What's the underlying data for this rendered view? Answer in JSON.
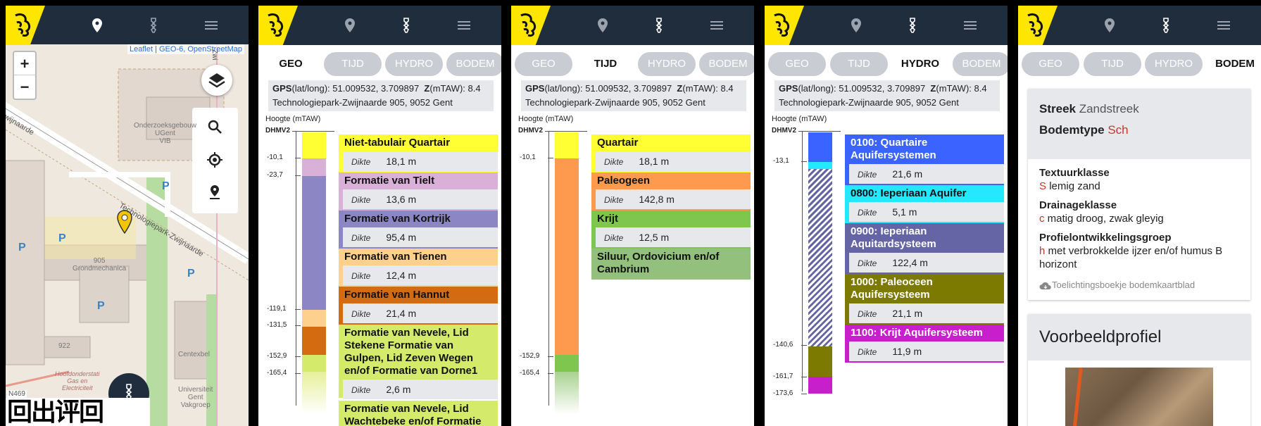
{
  "map": {
    "attribution": "Leaflet | GEO-6, OpenStreetMap",
    "zoom_in": "+",
    "zoom_out": "−",
    "labels": {
      "road1": "Technologiepark-Zwijnaarde",
      "road2": "wijnaarde",
      "bld1": "Onderzoeksgebouw\nUGent\nVIB",
      "bld2": "905\nGrondmechanica",
      "bld3": "922",
      "bld4": "Centexbel",
      "bld5": "Universiteit\nGent\nVakgroep",
      "bld6": "Hoofdonderstati\nGas en\nElectriciteit",
      "road3": "N469",
      "p": "P",
      "side": "Zwi"
    }
  },
  "info": {
    "gps_label": "GPS",
    "gps_text": "(lat/long): 51.009532, 3.709897",
    "z_label": "Z",
    "z_text": "(mTAW): 8.4",
    "address": "Technologiepark-Zwijnaarde 905, 9052 Gent"
  },
  "tabs": [
    "GEO",
    "TIJD",
    "HYDRO",
    "BODEM"
  ],
  "hoogte": "Hoogte (mTAW)",
  "dhmv": "DHMV2",
  "dikte": "Dikte",
  "geo": {
    "ticks": [
      "-10,1",
      "-23,7",
      "-119,1",
      "-131,5",
      "-152,9",
      "-165,4"
    ],
    "layers": [
      {
        "name": "Niet-tabulair Quartair",
        "d": "18,1 m",
        "color": "#ffff33"
      },
      {
        "name": "Formatie van Tielt",
        "d": "13,6 m",
        "color": "#d8b0d8"
      },
      {
        "name": "Formatie van Kortrijk",
        "d": "95,4 m",
        "color": "#8d86c4"
      },
      {
        "name": "Formatie van Tienen",
        "d": "12,4 m",
        "color": "#fdd08d"
      },
      {
        "name": "Formatie van Hannut",
        "d": "21,4 m",
        "color": "#d56b10"
      },
      {
        "name": "Formatie van Nevele, Lid Stekene Formatie van Gulpen, Lid Zeven Wegen en/of Formatie van Dorne1",
        "d": "2,6 m",
        "color": "#d4ea6b"
      },
      {
        "name": "Formatie van Nevele, Lid Wachtebeke en/of Formatie van",
        "d": "",
        "color": "#d4ea6b"
      }
    ]
  },
  "tijd": {
    "ticks": [
      "-10,1",
      "-152,9",
      "-165,4"
    ],
    "layers": [
      {
        "name": "Quartair",
        "d": "18,1 m",
        "color": "#ffff33"
      },
      {
        "name": "Paleogeen",
        "d": "142,8 m",
        "color": "#fd9a4e"
      },
      {
        "name": "Krijt",
        "d": "12,5 m",
        "color": "#7fc64e"
      },
      {
        "name": "Siluur, Ordovicium en/of Cambrium",
        "d": "",
        "color": "#93c07c"
      }
    ]
  },
  "hydro": {
    "ticks": [
      "-13,1",
      "-140,6",
      "-161,7",
      "-173,6"
    ],
    "layers": [
      {
        "name": "0100: Quartaire Aquifersystemen",
        "d": "21,6 m",
        "color": "#3a63ff",
        "dark": true
      },
      {
        "name": "0800: Ieperiaan Aquifer",
        "d": "5,1 m",
        "color": "#24e8ff"
      },
      {
        "name": "0900: Ieperiaan Aquitardsysteem",
        "d": "122,4 m",
        "color": "#6565a6",
        "dark": true
      },
      {
        "name": "1000: Paleoceen Aquifersysteem",
        "d": "21,1 m",
        "color": "#7c7a00",
        "dark": true
      },
      {
        "name": "1100: Krijt Aquifersysteem",
        "d": "11,9 m",
        "color": "#c81ecb",
        "dark": true
      }
    ]
  },
  "bodem": {
    "streek_label": "Streek",
    "streek": "Zandstreek",
    "type_label": "Bodemtype",
    "type": "Sch",
    "textuur_label": "Textuurklasse",
    "textuur_code": "S",
    "textuur": "lemig zand",
    "drainage_label": "Drainageklasse",
    "drainage_code": "c",
    "drainage": "matig droog, zwak gleyig",
    "profiel_label": "Profielontwikkelingsgroep",
    "profiel_code": "h",
    "profiel": "met verbrokkelde ijzer en/of humus B horizont",
    "link": "Toelichtingsboekje bodemkaartblad",
    "voorbeeld": "Voorbeeldprofiel"
  },
  "qr": "回出评回"
}
